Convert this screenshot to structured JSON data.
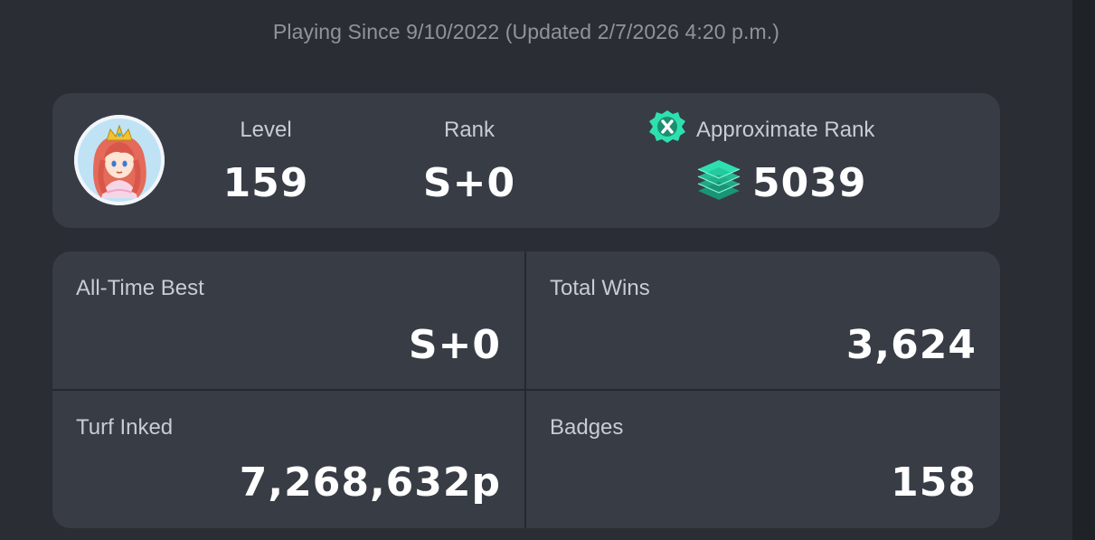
{
  "header": {
    "playing_since": "Playing Since 9/10/2022 (Updated 2/7/2026 4:20 p.m.)"
  },
  "profile": {
    "avatar_icon": "princess-avatar"
  },
  "summary": {
    "level_label": "Level",
    "level_value": "159",
    "rank_label": "Rank",
    "rank_value": "S+0",
    "approx_rank_label": "Approximate Rank",
    "approx_rank_icon": "x-battle-icon",
    "approx_rank_tier_icon": "stacked-layers-icon",
    "approx_rank_value": "5039",
    "accent_color": "#2ee0b0"
  },
  "stats": {
    "all_time_best_label": "All-Time Best",
    "all_time_best_value": "S+0",
    "total_wins_label": "Total Wins",
    "total_wins_value": "3,624",
    "turf_inked_label": "Turf Inked",
    "turf_inked_value": "7,268,632p",
    "badges_label": "Badges",
    "badges_value": "158"
  }
}
